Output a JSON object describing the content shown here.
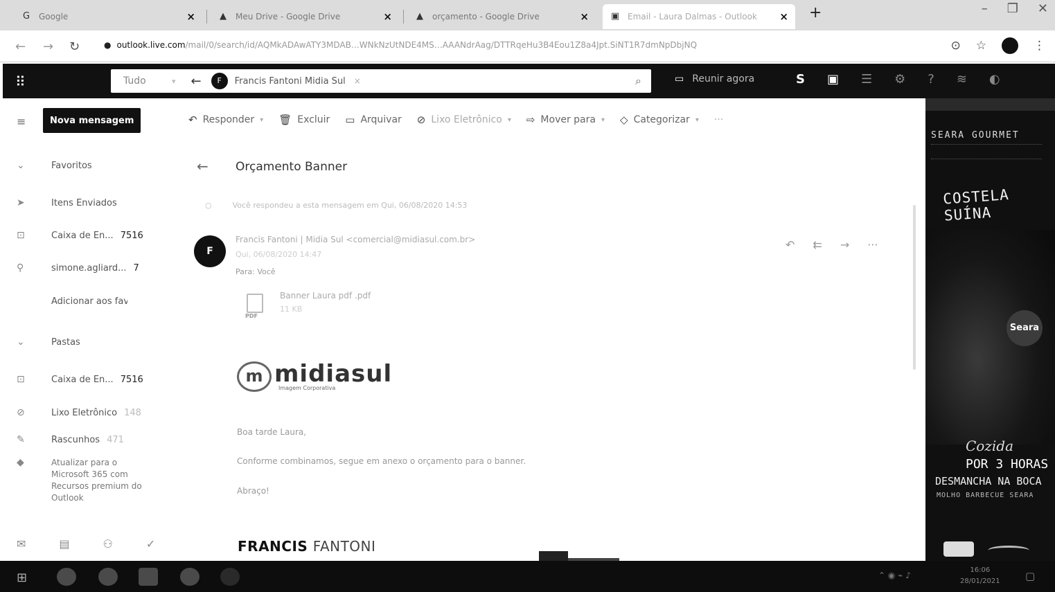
{
  "browser": {
    "tabs": [
      {
        "title": "Google",
        "icon": "google-icon",
        "active": false
      },
      {
        "title": "Meu Drive - Google Drive",
        "icon": "drive-icon",
        "active": false
      },
      {
        "title": "orçamento - Google Drive",
        "icon": "drive-icon",
        "active": false
      },
      {
        "title": "Email - Laura Dalmas - Outlook",
        "icon": "outlook-icon",
        "active": true
      }
    ],
    "close_glyph": "×",
    "new_tab_glyph": "+",
    "url_host": "outlook.live.com",
    "url_path": "/mail/0/search/id/AQMkADAwATY3MDAB…WNkNzUtNDE4MS…AAANdrAag/DTTRqeHu3B4Eou1Z8a4Jpt.SiNT1R7dmNpDbjNQ"
  },
  "outlook": {
    "search": {
      "scope": "Tudo",
      "chip_initial": "F",
      "chip_name": "Francis Fantoni Midia Sul",
      "chip_close": "×"
    },
    "meet_now": "Reunir agora",
    "new_message": "Nova mensagem",
    "toolbar": {
      "reply": "Responder",
      "delete": "Excluir",
      "archive": "Arquivar",
      "junk": "Lixo Eletrônico",
      "move_to": "Mover para",
      "categorize": "Categorizar",
      "more": "···"
    },
    "nav": {
      "favorites": "Favoritos",
      "sent_items": "Itens Enviados",
      "inbox_fav_label": "Caixa de En...",
      "inbox_fav_count": "7516",
      "simone_label": "simone.agliard...",
      "simone_count": "7",
      "add_favorite": "Adicionar aos fav...",
      "folders": "Pastas",
      "inbox_label": "Caixa de En...",
      "inbox_count": "7516",
      "junk_label": "Lixo Eletrônico",
      "junk_count": "148",
      "drafts_label": "Rascunhos",
      "drafts_count": "471",
      "upgrade": "Atualizar para o Microsoft 365 com Recursos premium do Outlook"
    },
    "message": {
      "subject": "Orçamento Banner",
      "replied_note": "Você respondeu a esta mensagem em Qui, 06/08/2020 14:53",
      "sender_initial": "F",
      "from": "Francis Fantoni | Midia Sul <comercial@midiasul.com.br>",
      "date": "Qui, 06/08/2020 14:47",
      "to": "Para: Você",
      "attachment_name": "Banner Laura pdf .pdf",
      "attachment_type": "PDF",
      "attachment_size": "11 KB",
      "logo_mark": "m",
      "logo_name": "midiasul",
      "logo_tagline": "Imagem Corporativa",
      "greeting": "Boa tarde Laura,",
      "body": "Conforme combinamos, segue em anexo o orçamento para o banner.",
      "closing": "Abraço!",
      "signature_first": "FRANCIS",
      "signature_last": "FANTONI"
    }
  },
  "ad": {
    "brand": "SEARA GOURMET",
    "headline": "COSTELA SUÍNA",
    "seal": "Seara",
    "cooked": "Cozida",
    "time": "POR 3 HORAS",
    "claim": "DESMANCHA NA BOCA",
    "slogan": "MOLHO BARBECUE SEARA"
  },
  "taskbar": {
    "time": "16:06",
    "date": "28/01/2021"
  },
  "colors": {
    "outlook_header": "#111111",
    "new_message_button": "#111111",
    "ad_background": "#101010",
    "taskbar": "#0d0d0d"
  }
}
